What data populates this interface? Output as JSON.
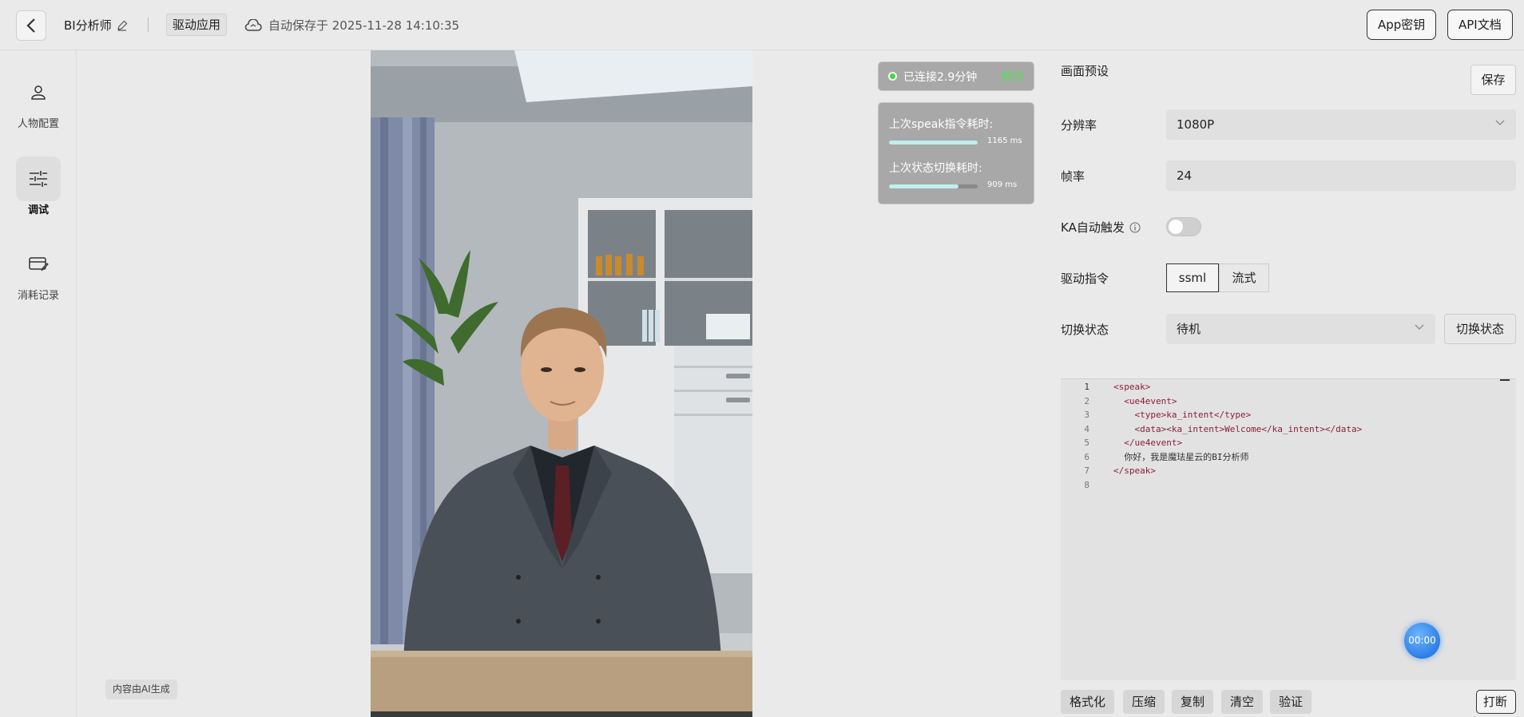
{
  "header": {
    "app_name": "BI分析师",
    "drive_tag": "驱动应用",
    "autosave": "自动保存于 2025-11-28 14:10:35",
    "app_key_btn": "App密钥",
    "api_doc_btn": "API文档"
  },
  "nav": {
    "items": [
      {
        "label": "人物配置",
        "icon": "person-icon"
      },
      {
        "label": "调试",
        "icon": "sliders-icon",
        "active": true
      },
      {
        "label": "消耗记录",
        "icon": "card-edit-icon"
      }
    ]
  },
  "ai_tag": "内容由AI生成",
  "status": {
    "connected": "已连接2.9分钟",
    "disconnect": "断开",
    "speak_label": "上次speak指令耗时:",
    "speak_value": "1165 ms",
    "speak_fraction": 1.0,
    "state_label": "上次状态切换耗时:",
    "state_value": "909 ms",
    "state_fraction": 0.78
  },
  "panel": {
    "title": "画面预设",
    "save": "保存",
    "resolution_label": "分辨率",
    "resolution_value": "1080P",
    "fps_label": "帧率",
    "fps_value": "24",
    "ka_label": "KA自动触发",
    "ka_enabled": false,
    "drive_cmd_label": "驱动指令",
    "drive_opt_ssml": "ssml",
    "drive_opt_stream": "流式",
    "state_label": "切换状态",
    "state_value": "待机",
    "state_btn": "切换状态"
  },
  "editor": {
    "lines": [
      {
        "n": "1",
        "text": "<speak>"
      },
      {
        "n": "2",
        "text": "  <ue4event>"
      },
      {
        "n": "3",
        "text": "    <type>ka_intent</type>"
      },
      {
        "n": "4",
        "text": "    <data><ka_intent>Welcome</ka_intent></data>"
      },
      {
        "n": "5",
        "text": "  </ue4event>"
      },
      {
        "n": "6",
        "text": "  你好，我是魔珐星云的BI分析师"
      },
      {
        "n": "7",
        "text": "</speak>"
      },
      {
        "n": "8",
        "text": ""
      }
    ]
  },
  "timer": "00:00",
  "toolbar": {
    "format": "格式化",
    "compress": "压缩",
    "copy": "复制",
    "clear": "清空",
    "validate": "验证",
    "print": "打断"
  },
  "colors": {
    "connected_dot": "#4bd14b",
    "disconnect_text": "#55e055",
    "progress_fill": "#bff0ec",
    "timer_blue": "#2d7ee6"
  }
}
